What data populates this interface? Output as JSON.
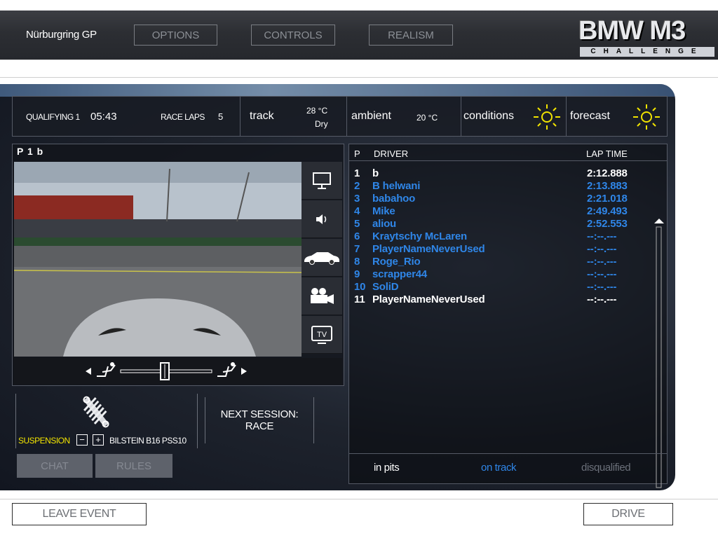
{
  "header": {
    "track_name": "Nürburgring GP",
    "buttons": {
      "options": "OPTIONS",
      "controls": "CONTROLS",
      "realism": "REALISM"
    },
    "logo": {
      "main": "BMW M3",
      "sub": "CHALLENGE"
    }
  },
  "session": {
    "type_label": "QUALIFYING 1",
    "time": "05:43",
    "laps_label": "RACE LAPS",
    "laps": "5",
    "track_label": "track",
    "track_temp": "28 °C",
    "track_state": "Dry",
    "ambient_label": "ambient",
    "ambient_temp": "20 °C",
    "conditions_label": "conditions",
    "conditions_icon": "sun-icon",
    "forecast_label": "forecast",
    "forecast_icon": "sun-icon"
  },
  "camera": {
    "title": "P 1  b",
    "side_buttons": [
      "monitor-icon",
      "speaker-icon",
      "car-icon",
      "camera-icon",
      "tv-icon"
    ],
    "tv_label": "TV"
  },
  "setup": {
    "suspension_label": "SUSPENSION",
    "minus": "−",
    "plus": "+",
    "suspension_value": "BILSTEIN B16 PSS10",
    "next_session_line1": "NEXT SESSION:",
    "next_session_line2": "RACE"
  },
  "buttons": {
    "chat": "CHAT",
    "rules": "RULES",
    "leave_event": "LEAVE EVENT",
    "drive": "DRIVE"
  },
  "standings": {
    "headers": {
      "position": "P",
      "driver": "DRIVER",
      "lap_time": "LAP TIME"
    },
    "rows": [
      {
        "p": "1",
        "driver": "b",
        "time": "2:12.888",
        "status": "in_pits"
      },
      {
        "p": "2",
        "driver": "B helwani",
        "time": "2:13.883",
        "status": "on_track"
      },
      {
        "p": "3",
        "driver": "babahoo",
        "time": "2:21.018",
        "status": "on_track"
      },
      {
        "p": "4",
        "driver": "Mike",
        "time": "2:49.493",
        "status": "on_track"
      },
      {
        "p": "5",
        "driver": "aliou",
        "time": "2:52.553",
        "status": "on_track"
      },
      {
        "p": "6",
        "driver": "Kraytschy McLaren",
        "time": "--:--.---",
        "status": "on_track"
      },
      {
        "p": "7",
        "driver": "PlayerNameNeverUsed",
        "time": "--:--.---",
        "status": "on_track"
      },
      {
        "p": "8",
        "driver": "Roge_Rio",
        "time": "--:--.---",
        "status": "on_track"
      },
      {
        "p": "9",
        "driver": "scrapper44",
        "time": "--:--.---",
        "status": "on_track"
      },
      {
        "p": "10",
        "driver": "SoliD",
        "time": "--:--.---",
        "status": "on_track"
      },
      {
        "p": "11",
        "driver": "PlayerNameNeverUsed",
        "time": "--:--.---",
        "status": "in_pits"
      }
    ],
    "legend": {
      "in_pits": "in pits",
      "on_track": "on track",
      "disqualified": "disqualified"
    }
  },
  "colors": {
    "in_pits": "#ffffff",
    "on_track": "#2f86e8",
    "disqualified": "#6b707a",
    "accent_yellow": "#f2e400"
  }
}
